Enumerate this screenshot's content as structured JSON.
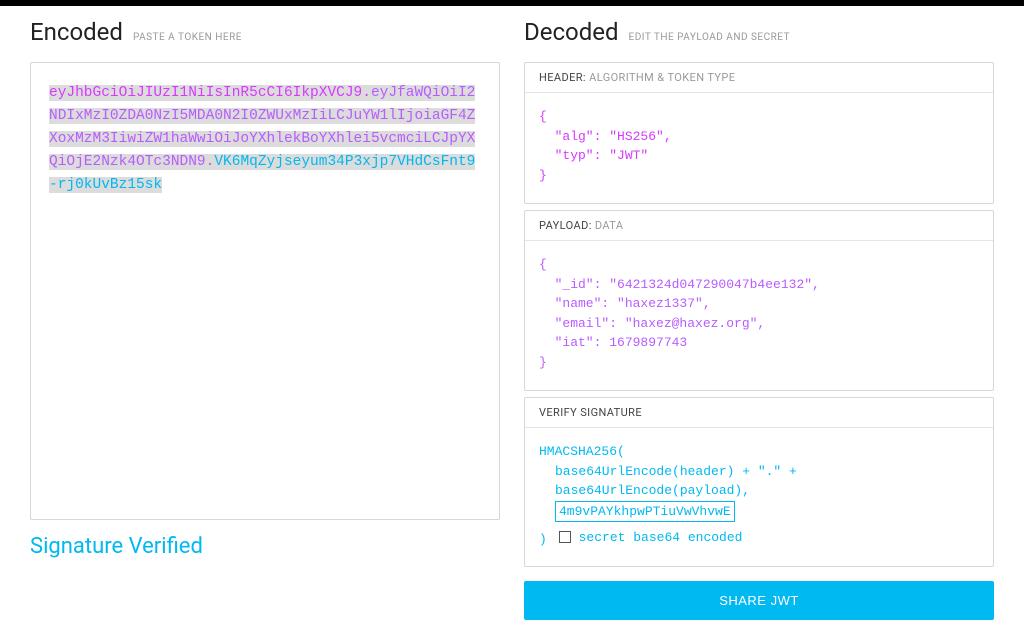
{
  "encoded": {
    "title": "Encoded",
    "hint": "PASTE A TOKEN HERE",
    "token": {
      "header": "eyJhbGciOiJIUzI1NiIsInR5cCI6IkpXVCJ9",
      "payload": "eyJfaWQiOiI2NDIxMzI0ZDA0NzI5MDA0N2I0ZWUxMzIiLCJuYW1lIjoiaGF4ZXoxMzM3IiwiZW1haWwiOiJoYXhlekBoYXhlei5vcmciLCJpYXQiOjE2Nzk4OTc3NDN9",
      "signature": "VK6MqZyjseyum34P3xjp7VHdCsFnt9-rj0kUvBz15sk",
      "dot": "."
    }
  },
  "decoded": {
    "title": "Decoded",
    "hint": "EDIT THE PAYLOAD AND SECRET",
    "header": {
      "label": "HEADER:",
      "sublabel": "ALGORITHM & TOKEN TYPE",
      "json": "{\n  \"alg\": \"HS256\",\n  \"typ\": \"JWT\"\n}"
    },
    "payload": {
      "label": "PAYLOAD:",
      "sublabel": "DATA",
      "json": "{\n  \"_id\": \"6421324d047290047b4ee132\",\n  \"name\": \"haxez1337\",\n  \"email\": \"haxez@haxez.org\",\n  \"iat\": 1679897743\n}"
    },
    "signature": {
      "label": "VERIFY SIGNATURE",
      "func": "HMACSHA256(",
      "line1": "base64UrlEncode(header) + \".\" +",
      "line2": "base64UrlEncode(payload),",
      "secret_value": "4m9vPAYkhpwPTiuVwVhvwE",
      "close": ")",
      "checkbox_label": "secret base64 encoded"
    }
  },
  "verified": "Signature Verified",
  "share": "SHARE JWT"
}
